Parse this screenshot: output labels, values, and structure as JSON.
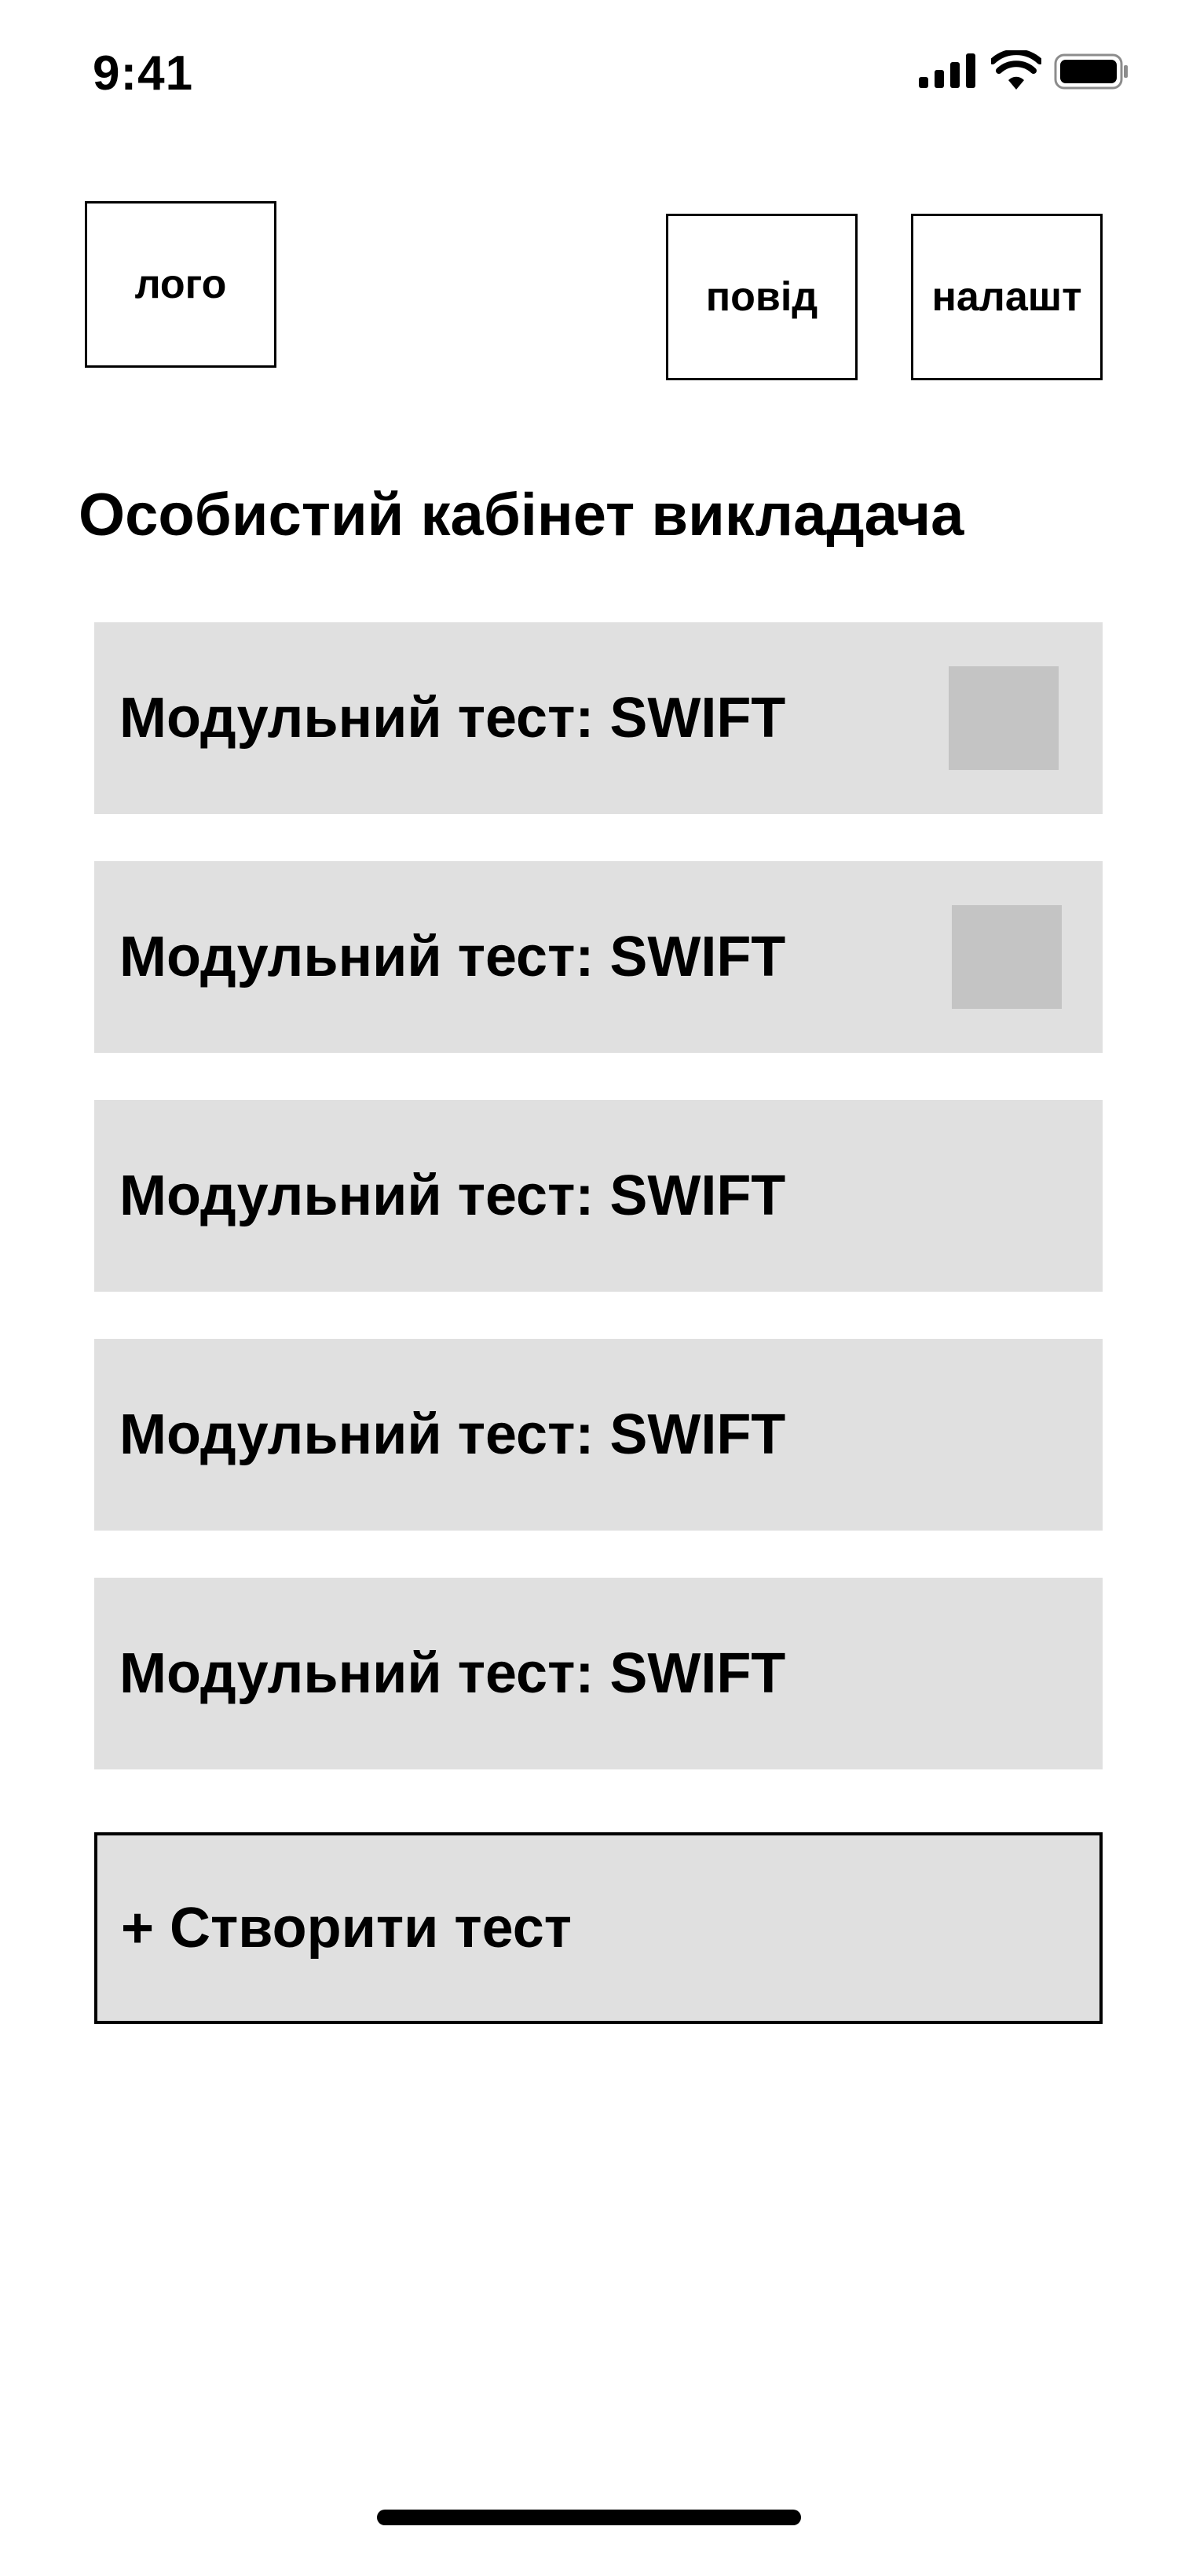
{
  "status_bar": {
    "time": "9:41",
    "icons": [
      "cellular-signal-icon",
      "wifi-icon",
      "battery-icon"
    ]
  },
  "header": {
    "logo_label": "лого",
    "notifications_label": "повід",
    "settings_label": "налашт"
  },
  "page": {
    "title": "Особистий кабінет викладача"
  },
  "tests": [
    {
      "label": "Модульний тест: SWIFT",
      "has_thumbnail": true
    },
    {
      "label": "Модульний тест: SWIFT",
      "has_thumbnail": true
    },
    {
      "label": "Модульний тест: SWIFT",
      "has_thumbnail": false
    },
    {
      "label": "Модульний тест: SWIFT",
      "has_thumbnail": false
    },
    {
      "label": "Модульний тест: SWIFT",
      "has_thumbnail": false
    }
  ],
  "actions": {
    "create_test_label": "+ Створити тест"
  },
  "colors": {
    "card_background": "#e0e0e0",
    "thumbnail": "#c4c4c4",
    "text": "#000000",
    "background": "#ffffff"
  }
}
